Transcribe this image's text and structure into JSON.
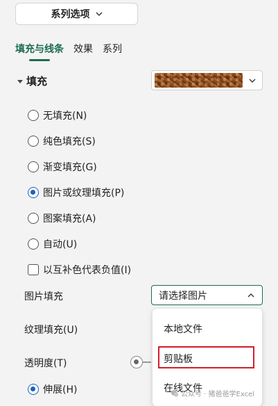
{
  "header": {
    "series_select": "系列选项"
  },
  "tabs": [
    {
      "label": "填充与线条",
      "active": true
    },
    {
      "label": "效果",
      "active": false
    },
    {
      "label": "系列",
      "active": false
    }
  ],
  "fill_section": {
    "title": "填充",
    "texture_preview": "leather-texture"
  },
  "fill_options": [
    {
      "label": "无填充(N)",
      "selected": false
    },
    {
      "label": "纯色填充(S)",
      "selected": false
    },
    {
      "label": "渐变填充(G)",
      "selected": false
    },
    {
      "label": "图片或纹理填充(P)",
      "selected": true
    },
    {
      "label": "图案填充(A)",
      "selected": false
    },
    {
      "label": "自动(U)",
      "selected": false
    }
  ],
  "invert_checkbox": {
    "label": "以互补色代表负值(I)",
    "checked": false
  },
  "picture_fill": {
    "label": "图片填充",
    "select_value": "请选择图片"
  },
  "texture_fill": {
    "label": "纹理填充(U)"
  },
  "transparency": {
    "label": "透明度(T)"
  },
  "stretch": {
    "label": "伸展(H)",
    "selected": true
  },
  "menu": {
    "items": [
      "本地文件",
      "剪贴板",
      "在线文件"
    ],
    "highlighted": "剪贴板"
  },
  "watermark": {
    "text": "公众号 · 猪爸爸学Excel"
  },
  "colors": {
    "accent": "#1d6b54",
    "radio": "#1f5fbf",
    "highlight": "#d0202b"
  }
}
